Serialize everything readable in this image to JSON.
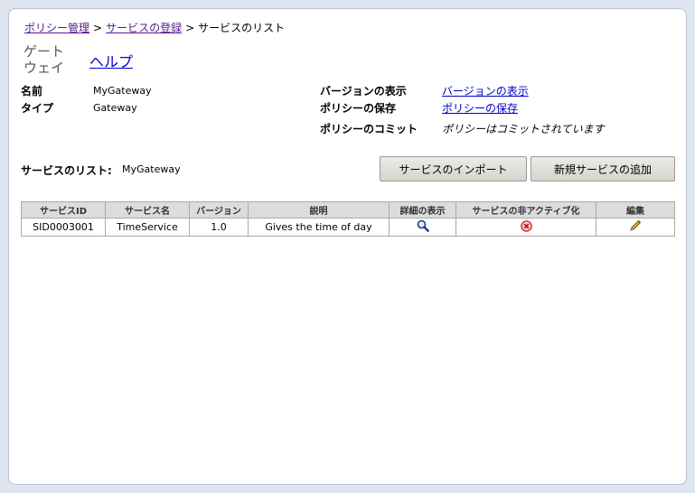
{
  "breadcrumb": {
    "item1": "ポリシー管理",
    "sep1": ">",
    "item2": "サービスの登録",
    "sep2": ">",
    "current": "サービスのリスト"
  },
  "header": {
    "title_line1": "ゲート",
    "title_line2": "ウェイ",
    "help": "ヘルプ"
  },
  "info": {
    "name_label": "名前",
    "name_value": "MyGateway",
    "type_label": "タイプ",
    "type_value": "Gateway",
    "version_label": "バージョンの表示",
    "version_link": "バージョンの表示",
    "save_label": "ポリシーの保存",
    "save_link": "ポリシーの保存",
    "commit_label": "ポリシーのコミット",
    "commit_status": "ポリシーはコミットされています"
  },
  "service_list": {
    "label": "サービスのリスト:",
    "value": "MyGateway"
  },
  "buttons": {
    "import": "サービスのインポート",
    "add": "新規サービスの追加"
  },
  "table": {
    "columns": [
      "サービスID",
      "サービス名",
      "バージョン",
      "説明",
      "詳細の表示",
      "サービスの非アクティブ化",
      "編集"
    ],
    "rows": [
      {
        "id": "SID0003001",
        "name": "TimeService",
        "version": "1.0",
        "description": "Gives the time of day",
        "view_icon": "magnifier-icon",
        "deactivate_icon": "red-x-circle-icon",
        "edit_icon": "pencil-icon"
      }
    ]
  },
  "colors": {
    "link": "#0000cc",
    "visited_link": "#551a8b",
    "header_bg": "#dcdcdc",
    "deactivate_red": "#d9201c"
  }
}
